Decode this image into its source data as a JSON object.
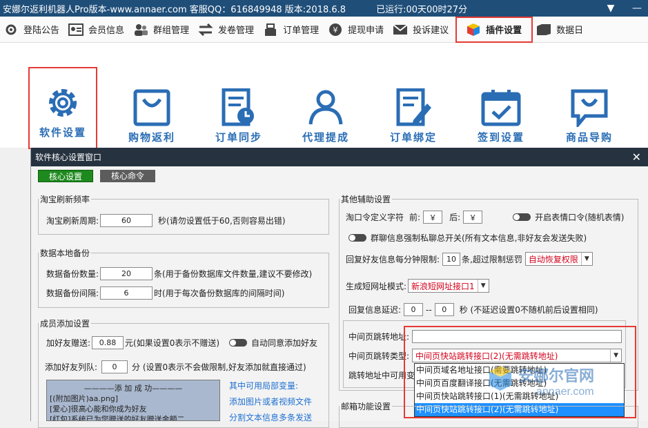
{
  "window": {
    "title": "安娜尔返利机器人Pro版本-www.annaer.com 客服QQ：616849948 版本:2018.6.8",
    "runtime": "已运行:00天00时27分"
  },
  "toolbar": [
    {
      "label": "登陆公告",
      "icon": "gear-check-icon"
    },
    {
      "label": "会员信息",
      "icon": "id-card-icon"
    },
    {
      "label": "群组管理",
      "icon": "users-icon"
    },
    {
      "label": "发卷管理",
      "icon": "swap-arrows-icon"
    },
    {
      "label": "订单管理",
      "icon": "cash-register-icon"
    },
    {
      "label": "提现申请",
      "icon": "yen-coin-icon"
    },
    {
      "label": "投诉建议",
      "icon": "mail-icon"
    },
    {
      "label": "插件设置",
      "icon": "cube-icon"
    },
    {
      "label": "数据日",
      "icon": "folder-icon"
    }
  ],
  "plugins": [
    {
      "label": "软件设置"
    },
    {
      "label": "购物返利"
    },
    {
      "label": "订单同步"
    },
    {
      "label": "代理提成"
    },
    {
      "label": "订单绑定"
    },
    {
      "label": "签到设置"
    },
    {
      "label": "商品导购"
    }
  ],
  "dialog": {
    "title": "软件核心设置窗口",
    "tabs": [
      "核心设置",
      "核心命令"
    ],
    "taobao_refresh": {
      "legend": "淘宝刷新频率",
      "label": "淘宝刷新周期:",
      "value": "60",
      "hint": "秒(请勿设置低于60,否则容易出错)"
    },
    "backup": {
      "legend": "数据本地备份",
      "count_label": "数据备份数量:",
      "count_value": "20",
      "count_hint": "条(用于备份数据库文件数量,建议不要修改)",
      "interval_label": "数据备份间隔:",
      "interval_value": "6",
      "interval_hint": "时(用于每次备份数据库的间隔时间)"
    },
    "member": {
      "legend": "成员添加设置",
      "gift_label": "加好友赠送:",
      "gift_value": "0.88",
      "gift_hint": "元(如果设置0表示不赠送)",
      "auto_agree": "自动同意添加好友",
      "queue_label": "添加好友列队:",
      "queue_value": "0",
      "queue_hint": "分 (设置0表示不会做限制,好友添加就直接通过)",
      "message_lines": [
        "————添 加 成 功————",
        "[(附加图片)aa.png]",
        "[爱心]很高心能和你成为好友",
        "[红包]系统已为您赠送的好友赠送金额二"
      ],
      "vars_title": "其中可用局部变量:",
      "link1": "添加图片或者视频文件",
      "link2": "分割文本信息多条发送"
    },
    "other": {
      "legend": "其他辅助设置",
      "tkl_label": "淘口令定义字符",
      "front_label": "前:",
      "front_value": "￥",
      "back_label": "后:",
      "back_value": "￥",
      "emoji_toggle": "开启表情口令(随机表情)",
      "private_toggle": "群聊信息强制私聊总开关(所有文本信息,非好友会发送失败)",
      "reply_limit_label": "回复好友信息每分钟限制:",
      "reply_limit_value": "10",
      "reply_limit_hint": "条,超过限制惩罚",
      "penalty_value": "自动恢复权限",
      "short_mode_label": "生成短网址模式:",
      "short_mode_value": "新浪短网址接口1",
      "delay_label": "回复信息延迟:",
      "delay_from": "0",
      "delay_sep": "--",
      "delay_to": "0",
      "delay_hint": "秒 (不延迟设置0不随机前后设置相同)",
      "jump_addr_label": "中间页跳转地址:",
      "jump_addr_value": "",
      "jump_type_label": "中间页跳转类型:",
      "jump_type_value": "中间页快站跳转接口(2)(无需跳转地址)",
      "jump_usable_label": "跳转地址中可用变",
      "jump_options": [
        "中间页域名地址接口(需要跳转地址)",
        "中间页百度翻译接口(无需跳转地址)",
        "中间页快站跳转接口(1)(无需跳转地址)",
        "中间页快站跳转接口(2)(无需跳转地址)"
      ],
      "selected_option_index": 3
    },
    "mail_legend": "邮箱功能设置"
  },
  "colors": {
    "title_bar": "#1f4e79",
    "accent_blue": "#2a6db5",
    "highlight_red": "#e53935",
    "active_tab": "#1e8a1e",
    "select_blue": "#1e90ff"
  }
}
